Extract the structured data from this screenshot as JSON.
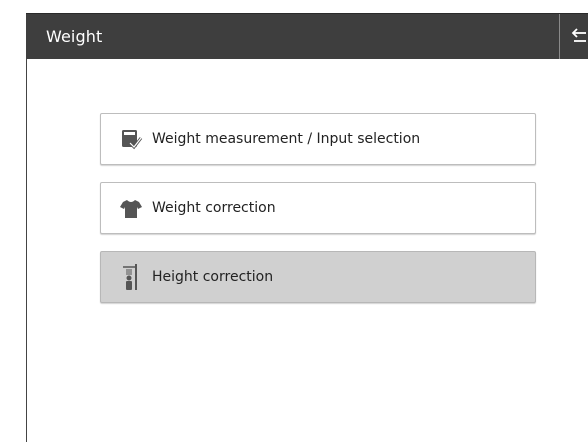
{
  "header": {
    "title": "Weight",
    "switch_icon": "swap-arrows-icon"
  },
  "menu": {
    "items": [
      {
        "label": "Weight measurement / Input selection",
        "icon": "scale-checkmark-icon",
        "selected": false
      },
      {
        "label": "Weight correction",
        "icon": "shirt-icon",
        "selected": false
      },
      {
        "label": "Height correction",
        "icon": "height-gauge-icon",
        "selected": true
      }
    ]
  },
  "colors": {
    "titlebar": "#3e3e3e",
    "selected_button": "#d0d0d0",
    "icon": "#555555"
  }
}
